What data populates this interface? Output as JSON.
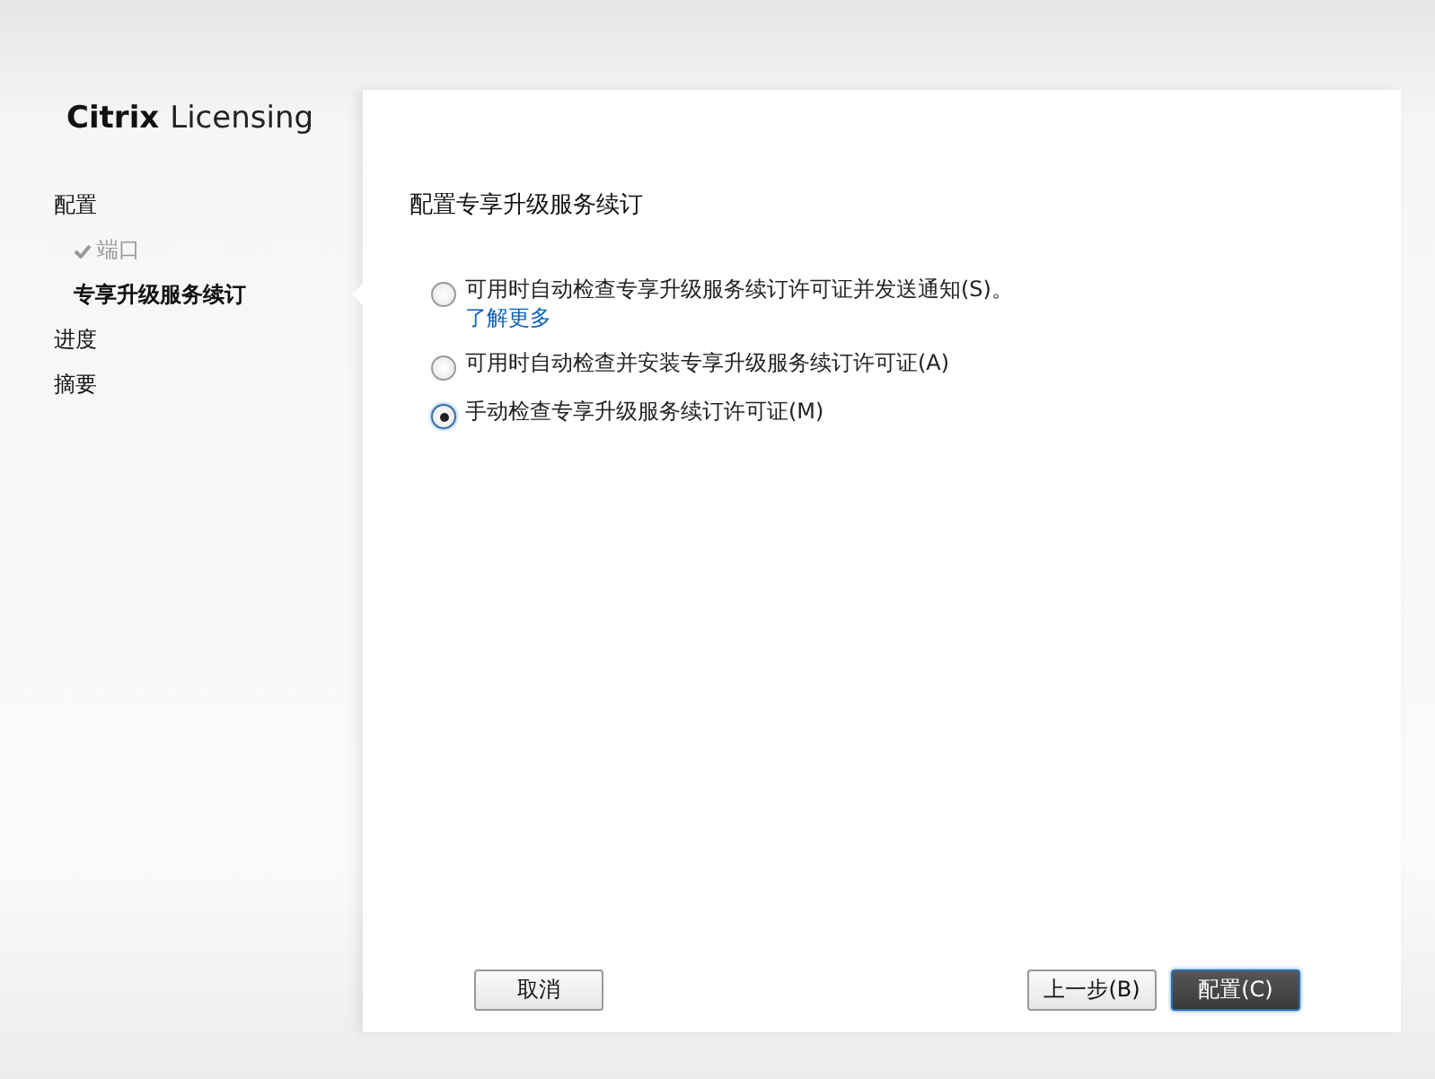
{
  "logo": {
    "brand": "Citrix",
    "product": "Licensing"
  },
  "nav": [
    {
      "label": "配置",
      "selected": false,
      "done": false,
      "children": [
        {
          "label": "端口",
          "selected": false,
          "done": true
        },
        {
          "label": "专享升级服务续订",
          "selected": true,
          "done": false
        }
      ]
    },
    {
      "label": "进度",
      "selected": false,
      "done": false
    },
    {
      "label": "摘要",
      "selected": false,
      "done": false
    }
  ],
  "page_title": "配置专享升级服务续订",
  "options": [
    {
      "label": "可用时自动检查专享升级服务续订许可证并发送通知(S)。",
      "link": "了解更多",
      "selected": false
    },
    {
      "label": "可用时自动检查并安装专享升级服务续订许可证(A)",
      "selected": false
    },
    {
      "label": "手动检查专享升级服务续订许可证(M)",
      "selected": true
    }
  ],
  "buttons": [
    {
      "label": "取消",
      "kind": "secondary"
    },
    {
      "label": "上一步(B)",
      "kind": "secondary"
    },
    {
      "label": "配置(C)",
      "kind": "primary"
    }
  ]
}
